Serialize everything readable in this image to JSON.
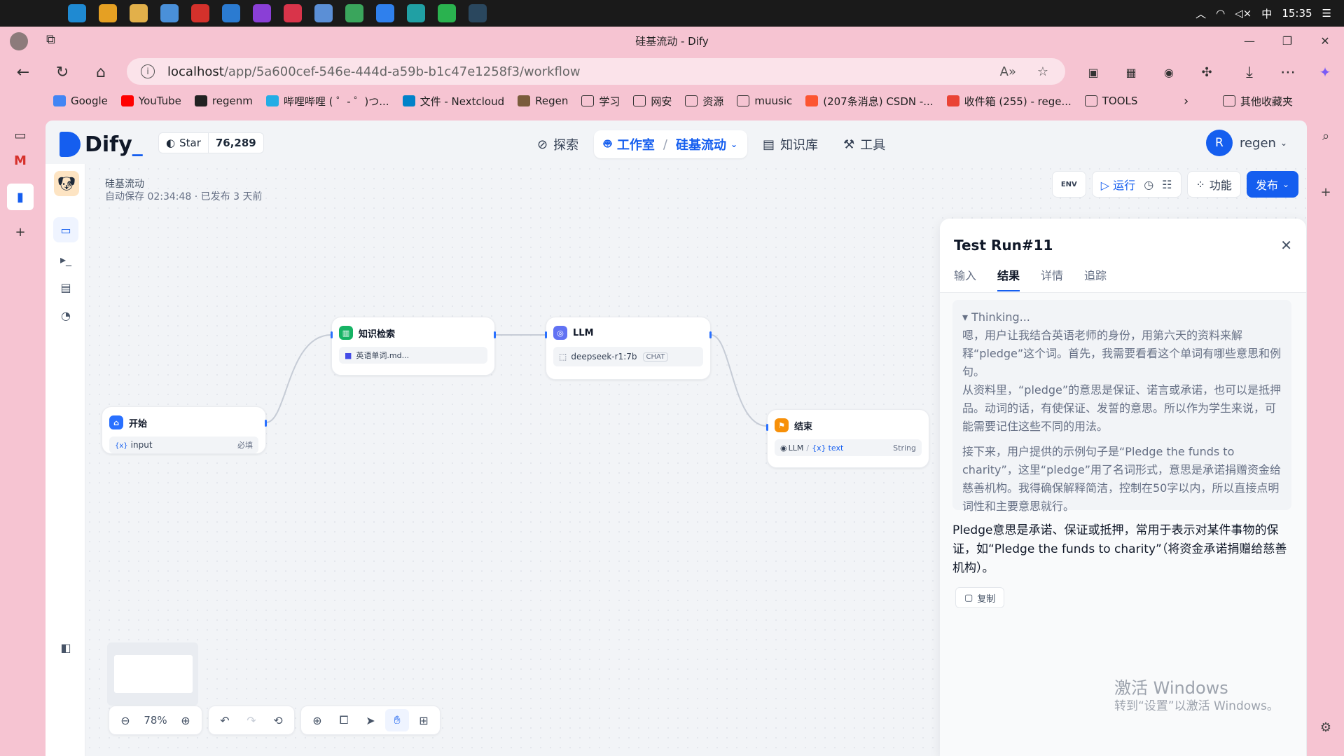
{
  "taskbar": {
    "clock": "15:35",
    "ime": "中",
    "apps": [
      {
        "icon": "windows-start-icon",
        "color": "#1a1a1a"
      },
      {
        "icon": "search-icon",
        "color": "#1a1a1a"
      },
      {
        "icon": "edge-icon",
        "color": "#1f8ad2"
      },
      {
        "icon": "chrome-icon",
        "color": "#e5a023"
      },
      {
        "icon": "explorer-icon",
        "color": "#e2b04a"
      },
      {
        "icon": "store-icon",
        "color": "#4a90d9"
      },
      {
        "icon": "wps-icon",
        "color": "#d4312b"
      },
      {
        "icon": "vscode-icon",
        "color": "#2b7bd1"
      },
      {
        "icon": "jetbrains-icon",
        "color": "#8a3fd6"
      },
      {
        "icon": "xmind-icon",
        "color": "#d9344a"
      },
      {
        "icon": "photos-icon",
        "color": "#5b8fd6"
      },
      {
        "icon": "qt-icon",
        "color": "#3aa55c"
      },
      {
        "icon": "app-icon",
        "color": "#2f80ed"
      },
      {
        "icon": "arduino-icon",
        "color": "#20a0a4"
      },
      {
        "icon": "wechat-icon",
        "color": "#2ab24f"
      },
      {
        "icon": "steam-icon",
        "color": "#2a475e"
      }
    ]
  },
  "browser": {
    "tab_title": "硅基流动 - Dify",
    "url_host": "localhost",
    "url_path": "/app/5a600cef-546e-444d-a59b-b1c47e1258f3/workflow",
    "bookmarks": [
      {
        "label": "Google",
        "color": "#4285f4"
      },
      {
        "label": "YouTube",
        "color": "#ff0000"
      },
      {
        "label": "regenm",
        "color": "#222222"
      },
      {
        "label": "哔哩哔哩 ( ゜- ゜)つ...",
        "color": "#23ade5"
      },
      {
        "label": "文件 - Nextcloud",
        "color": "#0082c9"
      },
      {
        "label": "Regen",
        "color": "#7a5c3c"
      },
      {
        "label": "学习",
        "color": "folder"
      },
      {
        "label": "网安",
        "color": "folder"
      },
      {
        "label": "资源",
        "color": "folder"
      },
      {
        "label": "muusic",
        "color": "folder"
      },
      {
        "label": "(207条消息) CSDN -...",
        "color": "#fc5531"
      },
      {
        "label": "收件箱 (255) - rege...",
        "color": "#ea4335"
      },
      {
        "label": "TOOLS",
        "color": "folder"
      }
    ],
    "other_bookmarks": "其他收藏夹"
  },
  "app": {
    "brand": "Dify",
    "github": {
      "star_label": "Star",
      "count": "76,289"
    },
    "nav": {
      "explore": "探索",
      "studio": "工作室",
      "current_app": "硅基流动",
      "knowledge": "知识库",
      "tools": "工具"
    },
    "user": {
      "initial": "R",
      "name": "regen"
    },
    "workflow": {
      "title": "硅基流动",
      "subtitle": "自动保存 02:34:48 · 已发布 3 天前"
    },
    "toolbar": {
      "env": "ENV",
      "run": "运行",
      "features": "功能",
      "publish": "发布"
    },
    "nodes": {
      "start": {
        "title": "开始",
        "var": "input",
        "required": "必填"
      },
      "knowledge": {
        "title": "知识检索",
        "dataset": "英语单词.md..."
      },
      "llm": {
        "title": "LLM",
        "model": "deepseek-r1:7b",
        "mode": "CHAT"
      },
      "end": {
        "title": "结束",
        "source": "LLM",
        "var": "text",
        "type": "String"
      }
    },
    "zoom": "78%"
  },
  "panel": {
    "title": "Test Run#11",
    "tabs": [
      "输入",
      "结果",
      "详情",
      "追踪"
    ],
    "active_tab": "结果",
    "thinking_label": "▾ Thinking...",
    "thinking_p1": "嗯，用户让我结合英语老师的身份，用第六天的资料来解释“pledge”这个词。首先，我需要看看这个单词有哪些意思和例句。",
    "thinking_p2": "从资料里，“pledge”的意思是保证、诺言或承诺，也可以是抵押品。动词的话，有使保证、发誓的意思。所以作为学生来说，可能需要记住这些不同的用法。",
    "thinking_p3": "接下来，用户提供的示例句子是“Pledge the funds to charity”，这里“pledge”用了名词形式，意思是承诺捐赠资金给慈善机构。我得确保解释简洁，控制在50字以内，所以直接点明词性和主要意思就行。",
    "answer": "Pledge意思是承诺、保证或抵押，常用于表示对某件事物的保证，如“Pledge the funds to charity”（将资金承诺捐赠给慈善机构）。",
    "copy": "复制"
  },
  "watermark": {
    "line1": "激活 Windows",
    "line2": "转到“设置”以激活 Windows。"
  }
}
